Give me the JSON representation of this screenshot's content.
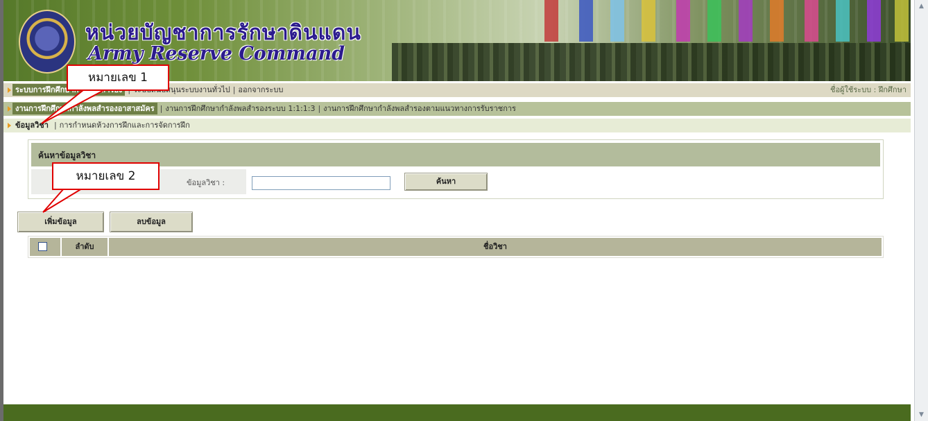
{
  "banner": {
    "title_th": "หน่วยบัญชาการรักษาดินแดน",
    "title_en": "Army Reserve Command"
  },
  "menu1": {
    "items": [
      {
        "label": "ระบบการฝึกศึกษากำลังพลสำรอง",
        "active": true
      },
      {
        "label": "ระบบสนับสนุนระบบงานทั่วไป"
      },
      {
        "label": "ออกจากระบบ"
      }
    ],
    "user_label": "ชื่อผู้ใช้ระบบ : ฝึกศึกษา"
  },
  "menu2": {
    "items": [
      {
        "label": "งานการฝึกศึกษากำลังพลสำรองอาสาสมัคร",
        "active": true
      },
      {
        "label": "งานการฝึกศึกษากำลังพลสำรองระบบ 1:1:1:3"
      },
      {
        "label": "งานการฝึกศึกษากำลังพลสำรองตามแนวทางการรับราชการ"
      }
    ]
  },
  "menu3": {
    "items": [
      {
        "label": "ข้อมูลวิชา",
        "active": true
      },
      {
        "label": "การกำหนดห้วงการฝึกและการจัดการฝึก"
      }
    ]
  },
  "search": {
    "title": "ค้นหาข้อมูลวิชา",
    "label": "ข้อมูลวิชา :",
    "value": "",
    "button": "ค้นหา"
  },
  "actions": {
    "add": "เพิ่มข้อมูล",
    "delete": "ลบข้อมูล"
  },
  "table": {
    "columns": [
      "ลำดับ",
      "ชื่อวิชา"
    ]
  },
  "callouts": {
    "c1": "หมายเลข 1",
    "c2": "หมายเลข 2"
  },
  "colors": {
    "banner_green": "#56792a",
    "menu_active": "#6e7f46",
    "footer": "#4a6b1f",
    "callout_red": "#e00000"
  }
}
